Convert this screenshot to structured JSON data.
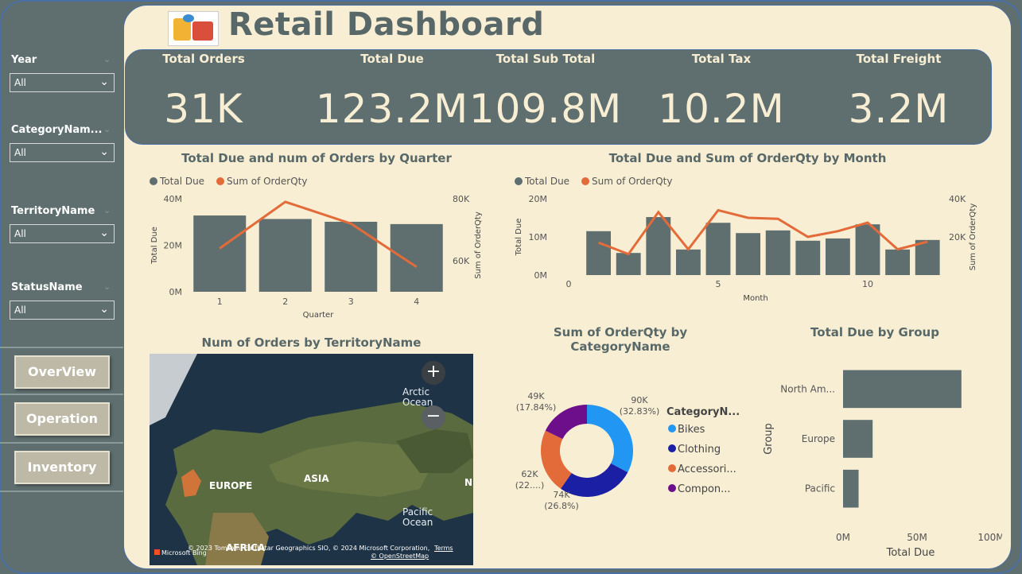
{
  "header": {
    "title": "Retail Dashboard"
  },
  "slicers": [
    {
      "label": "Year",
      "value": "All"
    },
    {
      "label": "CategoryNam...",
      "value": "All"
    },
    {
      "label": "TerritoryName",
      "value": "All"
    },
    {
      "label": "StatusName",
      "value": "All"
    }
  ],
  "nav": [
    {
      "label": "OverView"
    },
    {
      "label": "Operation"
    },
    {
      "label": "Inventory"
    }
  ],
  "kpis": [
    {
      "label": "Total Orders",
      "value": "31K"
    },
    {
      "label": "Total Due",
      "value": "123.2M"
    },
    {
      "label": "Total Sub Total",
      "value": "109.8M"
    },
    {
      "label": "Total Tax",
      "value": "10.2M"
    },
    {
      "label": "Total Freight",
      "value": "3.2M"
    }
  ],
  "colors": {
    "bar": "#5f6f6f",
    "line": "#e36b39",
    "bg": "#f8eed4",
    "bikes": "#2196f3",
    "clothing": "#1a1fa3",
    "accessories": "#e36b39",
    "components": "#6d0f8a"
  },
  "chart_data": [
    {
      "type": "bar",
      "title": "Total Due and num of Orders by Quarter",
      "legend": [
        "Total Due",
        "Sum of OrderQty"
      ],
      "xlabel": "Quarter",
      "ylabel": "Total Due",
      "y2label": "Sum of OrderQty",
      "categories": [
        "1",
        "2",
        "3",
        "4"
      ],
      "yticks": [
        "40M",
        "20M",
        "0M"
      ],
      "y2ticks": [
        "80K",
        "60K"
      ],
      "ylim": [
        0,
        40000000
      ],
      "y2lim": [
        50000,
        80000
      ],
      "series": [
        {
          "name": "Total Due",
          "type": "bar",
          "values": [
            32800000,
            31300000,
            30100000,
            29100000
          ]
        },
        {
          "name": "Sum of OrderQty",
          "type": "line",
          "values": [
            64000,
            79000,
            72000,
            58000
          ]
        }
      ]
    },
    {
      "type": "bar",
      "title": "Total Due and Sum of OrderQty by Month",
      "legend": [
        "Total Due",
        "Sum of OrderQty"
      ],
      "xlabel": "Month",
      "ylabel": "Total Due",
      "y2label": "Sum of OrderQty",
      "x": [
        1,
        2,
        3,
        4,
        5,
        6,
        7,
        8,
        9,
        10,
        11,
        12
      ],
      "xticks": [
        "0",
        "5",
        "10"
      ],
      "yticks": [
        "20M",
        "10M",
        "0M"
      ],
      "y2ticks": [
        "40K",
        "20K"
      ],
      "ylim": [
        0,
        20000000
      ],
      "y2lim": [
        0,
        40000
      ],
      "series": [
        {
          "name": "Total Due",
          "type": "bar",
          "values": [
            11500000,
            5800000,
            15200000,
            6700000,
            13700000,
            11000000,
            11700000,
            9000000,
            9600000,
            13300000,
            6700000,
            9200000
          ]
        },
        {
          "name": "Sum of OrderQty",
          "type": "line",
          "values": [
            17000,
            11000,
            33000,
            13500,
            34000,
            30000,
            29500,
            20000,
            23000,
            27500,
            13500,
            17500
          ]
        }
      ]
    },
    {
      "type": "pie",
      "title": "Sum of OrderQty by CategoryName",
      "legend_title": "CategoryN...",
      "slices": [
        {
          "name": "Bikes",
          "legend": "Bikes",
          "value": 90000,
          "label": "90K",
          "pct": "(32.83%)"
        },
        {
          "name": "Clothing",
          "legend": "Clothing",
          "value": 74000,
          "label": "74K",
          "pct": "(26.8%)"
        },
        {
          "name": "Accessories",
          "legend": "Accessori...",
          "value": 62000,
          "label": "62K",
          "pct": "(22....)"
        },
        {
          "name": "Components",
          "legend": "Compon...",
          "value": 49000,
          "label": "49K",
          "pct": "(17.84%)"
        }
      ]
    },
    {
      "type": "bar",
      "title": "Total Due by Group",
      "orientation": "horizontal",
      "xlabel": "Total Due",
      "ylabel": "Group",
      "categories": [
        "North Am...",
        "Europe",
        "Pacific"
      ],
      "values": [
        80000000,
        20000000,
        10500000
      ],
      "xticks": [
        "0M",
        "50M",
        "100M"
      ],
      "xlim": [
        0,
        100000000
      ]
    }
  ],
  "map": {
    "title": "Num of Orders by TerritoryName",
    "labels": {
      "europe": "EUROPE",
      "asia": "ASIA",
      "africa": "AFRICA",
      "arctic": "Arctic Ocean",
      "pacific": "Pacific Ocean",
      "edge": "N"
    },
    "zoom_in": "+",
    "zoom_out": "−",
    "attribution": "© 2023 TomTom, Earthstar Geographics SIO, © 2024 Microsoft Corporation,",
    "terms": "Terms",
    "osm": "© OpenStreetMap",
    "brand": "Microsoft Bing"
  }
}
